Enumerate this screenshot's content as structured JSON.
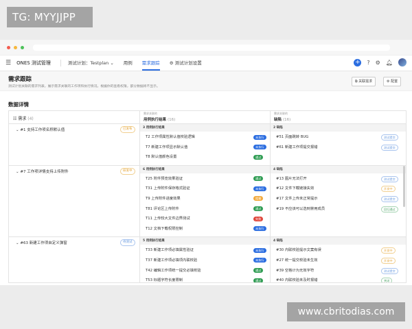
{
  "tag": "TG: MYYJJPP",
  "watermark": "www.cbritodias.com",
  "nav": {
    "app_name": "ONES 测试管理",
    "plan": "测试计划：Testplan",
    "items": [
      "用例",
      "需求跟踪",
      "测试计划设置"
    ],
    "active": "需求跟踪"
  },
  "page": {
    "title": "需求跟踪",
    "desc": "测试计划关联的需求列表，展示需求关联的工作项和执行情况，根据你的查看权限，部分数据将不显示。",
    "btn_link": "关联需求",
    "btn_config": "配置"
  },
  "section_title": "数据详情",
  "headers": {
    "req": "需求",
    "req_count": "(4)",
    "case_sub": "需求关联的",
    "case_main": "用例执行结果",
    "case_count": "(16)",
    "bug_sub": "需求关联的",
    "bug_main": "缺陷",
    "bug_count": "(16)"
  },
  "groups": [
    {
      "req": "#1 支持工作项名称默认值",
      "status": "已发布",
      "status_color": "orange",
      "case_header": "3 用例执行结果",
      "bug_header": "2 缺陷",
      "cases": [
        {
          "t": "T2 工作项属性默认值校验逻辑",
          "s": "未执行",
          "c": "run"
        },
        {
          "t": "T7 新建工作项显示默认值",
          "s": "未执行",
          "c": "run"
        },
        {
          "t": "T8 默认值颜色设置",
          "s": "通过",
          "c": "pass"
        }
      ],
      "bugs": [
        {
          "t": "#51 页面跳转 BUG",
          "s": "测试提交",
          "c": "blue"
        },
        {
          "t": "#61 新建工作项提交报错",
          "s": "测试提交",
          "c": "blue"
        }
      ]
    },
    {
      "req": "#7 工作项详情支持上传附件",
      "status": "研发中",
      "status_color": "orange",
      "case_header": "6 用例执行结果",
      "bug_header": "4 缺陷",
      "cases": [
        {
          "t": "T25 附件预览效果验证",
          "s": "通过",
          "c": "pass"
        },
        {
          "t": "T31 上传附件保存格式验证",
          "s": "未执行",
          "c": "run"
        },
        {
          "t": "T9 上传附件进度效果",
          "s": "阻塞",
          "c": "block"
        },
        {
          "t": "T81 评论区上传附件",
          "s": "通过",
          "c": "pass"
        },
        {
          "t": "T11 上传较大文件边界测试",
          "s": "失败",
          "c": "fail"
        },
        {
          "t": "T12 文档下载权限控制",
          "s": "未执行",
          "c": "run"
        }
      ],
      "bugs": [
        {
          "t": "#13 图片无法打开",
          "s": "测试提交",
          "c": "blue"
        },
        {
          "t": "#12 文件下载链接失效",
          "s": "开发中",
          "c": "orange"
        },
        {
          "t": "#17 文件上传未正常提示",
          "s": "测试提交",
          "c": "blue"
        },
        {
          "t": "#19 不应该可以选到禁用成员",
          "s": "回归通过",
          "c": "green"
        }
      ]
    },
    {
      "req": "#63 新建工作项自定义弹窗",
      "status": "待测试",
      "status_color": "blue",
      "case_header": "5 用例执行结果",
      "bug_header": "4 缺陷",
      "cases": [
        {
          "t": "T33 新建工作项必填属性验证",
          "s": "未执行",
          "c": "run"
        },
        {
          "t": "T37 新建工作项必填项内联校验",
          "s": "未执行",
          "c": "run"
        },
        {
          "t": "T42 编辑工作项统一提交必填校验",
          "s": "通过",
          "c": "pass"
        },
        {
          "t": "T53 标题字符长度限制",
          "s": "通过",
          "c": "pass"
        }
      ],
      "bugs": [
        {
          "t": "#30 内联校验提示文案有误",
          "s": "开发中",
          "c": "orange"
        },
        {
          "t": "#27 统一提交校验未生效",
          "s": "开发中",
          "c": "orange"
        },
        {
          "t": "#39 空格计为无效字符",
          "s": "测试提交",
          "c": "blue"
        },
        {
          "t": "#40 内联校验未及时报错",
          "s": "关闭",
          "c": "green"
        }
      ]
    }
  ]
}
